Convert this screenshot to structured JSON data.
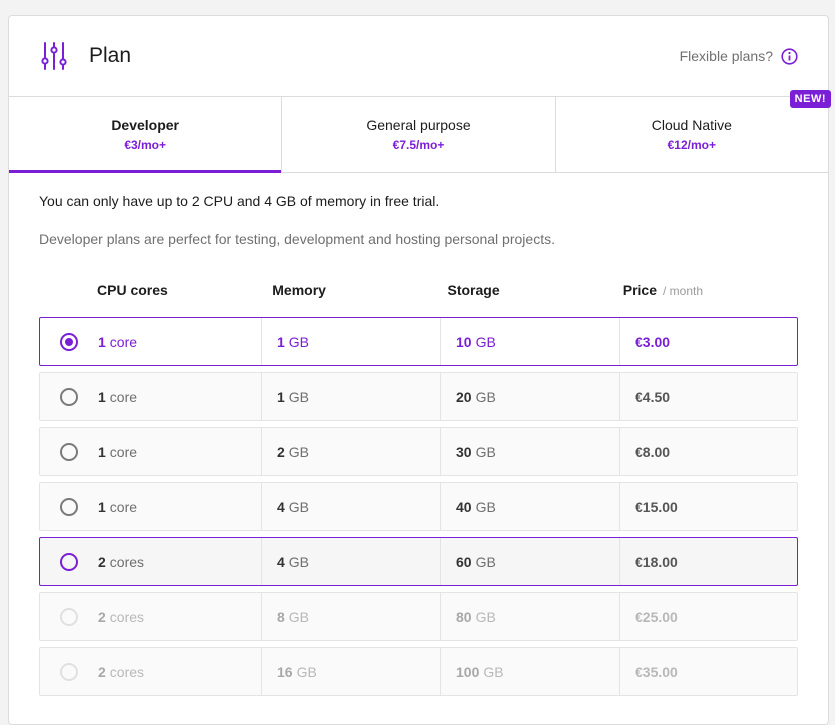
{
  "header": {
    "title": "Plan",
    "flexible_label": "Flexible plans?"
  },
  "tabs": [
    {
      "name": "Developer",
      "price": "€3/mo+",
      "active": true
    },
    {
      "name": "General purpose",
      "price": "€7.5/mo+",
      "active": false
    },
    {
      "name": "Cloud Native",
      "price": "€12/mo+",
      "active": false
    }
  ],
  "new_badge": "NEW!",
  "notice": "You can only have up to 2 CPU and 4 GB of memory in free trial.",
  "description": "Developer plans are perfect for testing, development and hosting personal projects.",
  "columns": {
    "cpu": "CPU cores",
    "memory": "Memory",
    "storage": "Storage",
    "price": "Price",
    "price_period": "/ month"
  },
  "rows": [
    {
      "cpu_num": "1",
      "cpu_unit": "core",
      "mem_num": "1",
      "mem_unit": "GB",
      "sto_num": "10",
      "sto_unit": "GB",
      "price": "€3.00",
      "state": "selected"
    },
    {
      "cpu_num": "1",
      "cpu_unit": "core",
      "mem_num": "1",
      "mem_unit": "GB",
      "sto_num": "20",
      "sto_unit": "GB",
      "price": "€4.50",
      "state": "normal"
    },
    {
      "cpu_num": "1",
      "cpu_unit": "core",
      "mem_num": "2",
      "mem_unit": "GB",
      "sto_num": "30",
      "sto_unit": "GB",
      "price": "€8.00",
      "state": "normal"
    },
    {
      "cpu_num": "1",
      "cpu_unit": "core",
      "mem_num": "4",
      "mem_unit": "GB",
      "sto_num": "40",
      "sto_unit": "GB",
      "price": "€15.00",
      "state": "normal"
    },
    {
      "cpu_num": "2",
      "cpu_unit": "cores",
      "mem_num": "4",
      "mem_unit": "GB",
      "sto_num": "60",
      "sto_unit": "GB",
      "price": "€18.00",
      "state": "highlight"
    },
    {
      "cpu_num": "2",
      "cpu_unit": "cores",
      "mem_num": "8",
      "mem_unit": "GB",
      "sto_num": "80",
      "sto_unit": "GB",
      "price": "€25.00",
      "state": "disabled"
    },
    {
      "cpu_num": "2",
      "cpu_unit": "cores",
      "mem_num": "16",
      "mem_unit": "GB",
      "sto_num": "100",
      "sto_unit": "GB",
      "price": "€35.00",
      "state": "disabled"
    }
  ],
  "colors": {
    "accent": "#7a1fd6"
  }
}
